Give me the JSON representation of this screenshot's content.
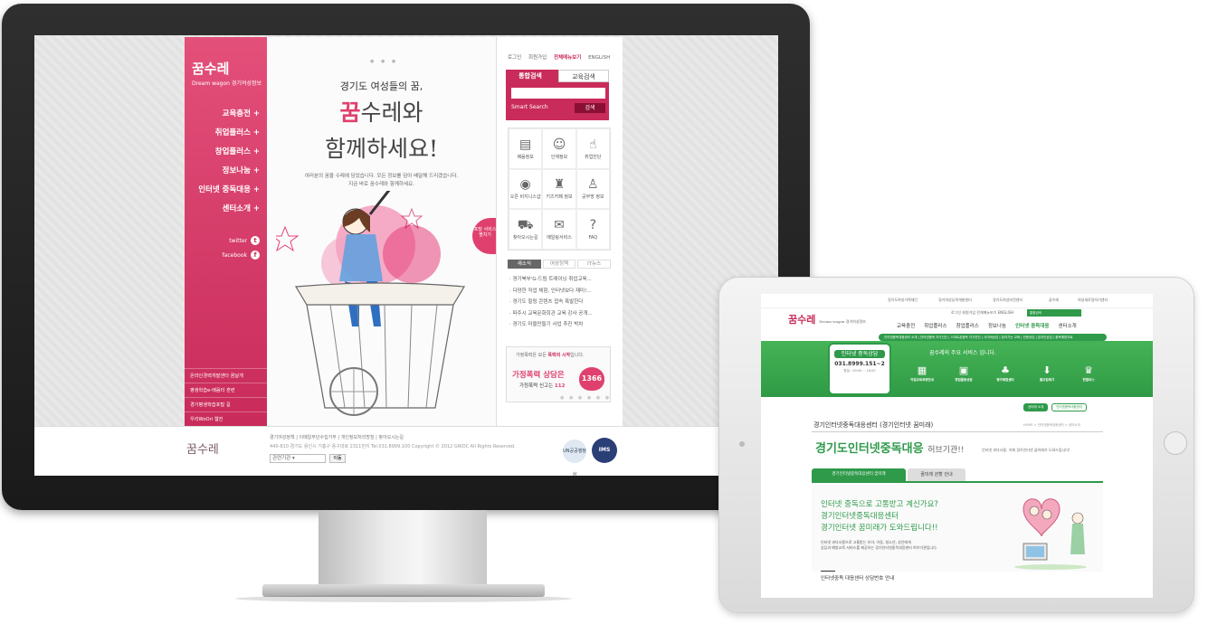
{
  "desktop": {
    "logo": {
      "name": "꿈수레",
      "sub": "Dream wagon 경기여성정보"
    },
    "nav": [
      "교육충전",
      "취업플러스",
      "창업플러스",
      "정보나눔",
      "인터넷 중독대응",
      "센터소개"
    ],
    "social": [
      {
        "label": "twitter",
        "glyph": "t"
      },
      {
        "label": "facebook",
        "glyph": "f"
      }
    ],
    "nav_links": [
      "온라인경력개발센터 꿈날개",
      "평생학습e-배움터 훈련",
      "경기평생학습포털 길",
      "우리WoOri 웹진"
    ],
    "hero": {
      "dots": "● ● ●",
      "subtitle": "경기도 여성들의 꿈,",
      "big1_main": "꿈",
      "big1_rest": "수레와",
      "big2": "함께하세요!",
      "desc": "여러분의 꿈을 수레에 담았습니다. 모든 정보를 담아 배달해 드리겠습니다. 지금 바로 꿈수레와 함께하세요.",
      "side_tab": "포털 서비스 펼치기"
    },
    "top_links": [
      "로그인",
      "회원가입",
      "전체메뉴보기",
      "ENGLISH"
    ],
    "search": {
      "tab_active": "통합검색",
      "tab_inactive": "교육검색",
      "smart": "Smart Search",
      "button": "검색"
    },
    "grid": [
      {
        "label": "배움정보",
        "icon": "document-icon",
        "glyph": "▤"
      },
      {
        "label": "인재정보",
        "icon": "profile-icon",
        "glyph": "☺"
      },
      {
        "label": "취업진단",
        "icon": "pointer-icon",
        "glyph": "☝"
      },
      {
        "label": "오픈 비지니스샵",
        "icon": "camera-icon",
        "glyph": "◉"
      },
      {
        "label": "키즈카페 정보",
        "icon": "hat-icon",
        "glyph": "♜"
      },
      {
        "label": "공부방 정보",
        "icon": "reading-icon",
        "glyph": "♙"
      },
      {
        "label": "찾아오시는길",
        "icon": "car-icon",
        "glyph": "⛟"
      },
      {
        "label": "메일링서비스",
        "icon": "mail-icon",
        "glyph": "✉"
      },
      {
        "label": "FAQ",
        "icon": "faq-icon",
        "glyph": "?"
      }
    ],
    "news_tabs": [
      "새소식",
      "여성정책",
      "IT뉴스"
    ],
    "news": [
      "경기북부'G-드림 트레이닝 취업교육...",
      "다양한 직업 체험, 인터넷보다 재미!...",
      "경기도 힐링 콘텐츠 접속 폭발한다",
      "파주시 교육문화회관 교육 강사 공개...",
      "경기도 마을만들기 사업 추진 박차"
    ],
    "violence": {
      "top": "가정폭력은 모든",
      "top_em": "폭력의 시작",
      "top_end": "입니다.",
      "title": "가정폭력 상담은",
      "sub": "가정폭력 신고는",
      "sub_em": "112",
      "hotline": "1366"
    },
    "slider_dots": "● ● ● ● ● ●",
    "footer": {
      "logo": "꿈수레",
      "links": "경기여성정책 | 이메일무단수집거부 | 개인정보처리방침 | 찾아오시는길",
      "addr": "440-810 경기도 용인시 기흥구 용구대로 2311번지 Tel.031.8999.100 Copyright © 2012 GWDC All Rights Reserved.",
      "select": "관련기관",
      "go": "이동",
      "badge1": "UN공공행정상",
      "badge2": "IMS"
    }
  },
  "tablet": {
    "top_items": [
      "경기도여성가족재단",
      "경기여성능력개발센터",
      "경기도여성비전센터",
      "꿈수레",
      "여성새로일하기센터"
    ],
    "logo": "꿈수레",
    "logo_sub": "Dream wagon 경기여성정보",
    "util": "로그인 회원가입 전체메뉴보기 ENGLISH",
    "search_label": "통합검색",
    "menu": [
      "교육충전",
      "취업플러스",
      "창업플러스",
      "정보나눔",
      "인터넷 중독대응",
      "센터소개"
    ],
    "submenu": "인터넷중독대응센터 소개 | 인터넷중독 자가진단 | 스마트폰중독 자가진단 | 사이버상담 | 찾아가는 교육 | 전문상담 | 온라인상담 | 중독예방자료",
    "consult": {
      "title": "인터넷 중독상담",
      "phone": "031.8999.151~2",
      "hours": "평일 : 09:00 ~ 18:00"
    },
    "service": "꿈수레의 주요 서비스 입니다.",
    "icons": [
      {
        "label": "직업교육과정안내",
        "glyph": "▦"
      },
      {
        "label": "창업활동상담",
        "glyph": "▣"
      },
      {
        "label": "평가체험센터",
        "glyph": "♣"
      },
      {
        "label": "불교업체기",
        "glyph": "⬇"
      },
      {
        "label": "헌혈리스",
        "glyph": "♛"
      }
    ],
    "mini": [
      "센터에 소개",
      "인터넷중독대응센터"
    ],
    "page_title": "경기인터넷중독대응센터 (경기인터넷 꿈미래)",
    "crumb": "HOME > 인터넷중독대응센터 > 센터소개",
    "big": "경기도인터넷중독대응",
    "big_rest": "허브기관!!",
    "right_text": "인터넷 과다사용, 이제 경기인터넷 꿈미래가 도와드립니다!",
    "tab1": "경기인터넷중독대응센터 꿈미래",
    "tab2": "꿈미래 관할 안내",
    "q1": "인터넷 중독으로 고통받고 계신가요?",
    "q2": "경기인터넷중독대응센터",
    "q3": "경기인터넷 꿈미래가 도와드립니다!!",
    "desc1": "인터넷 과다사용으로 고통받는 유아, 아동, 청소년, 성인에게",
    "desc2": "상담과 예방교육 서비스를 제공하는 경기인터넷중독대응센터 허브기관입니다.",
    "foot": "인터넷중독 대응센터 상담번호 안내"
  }
}
